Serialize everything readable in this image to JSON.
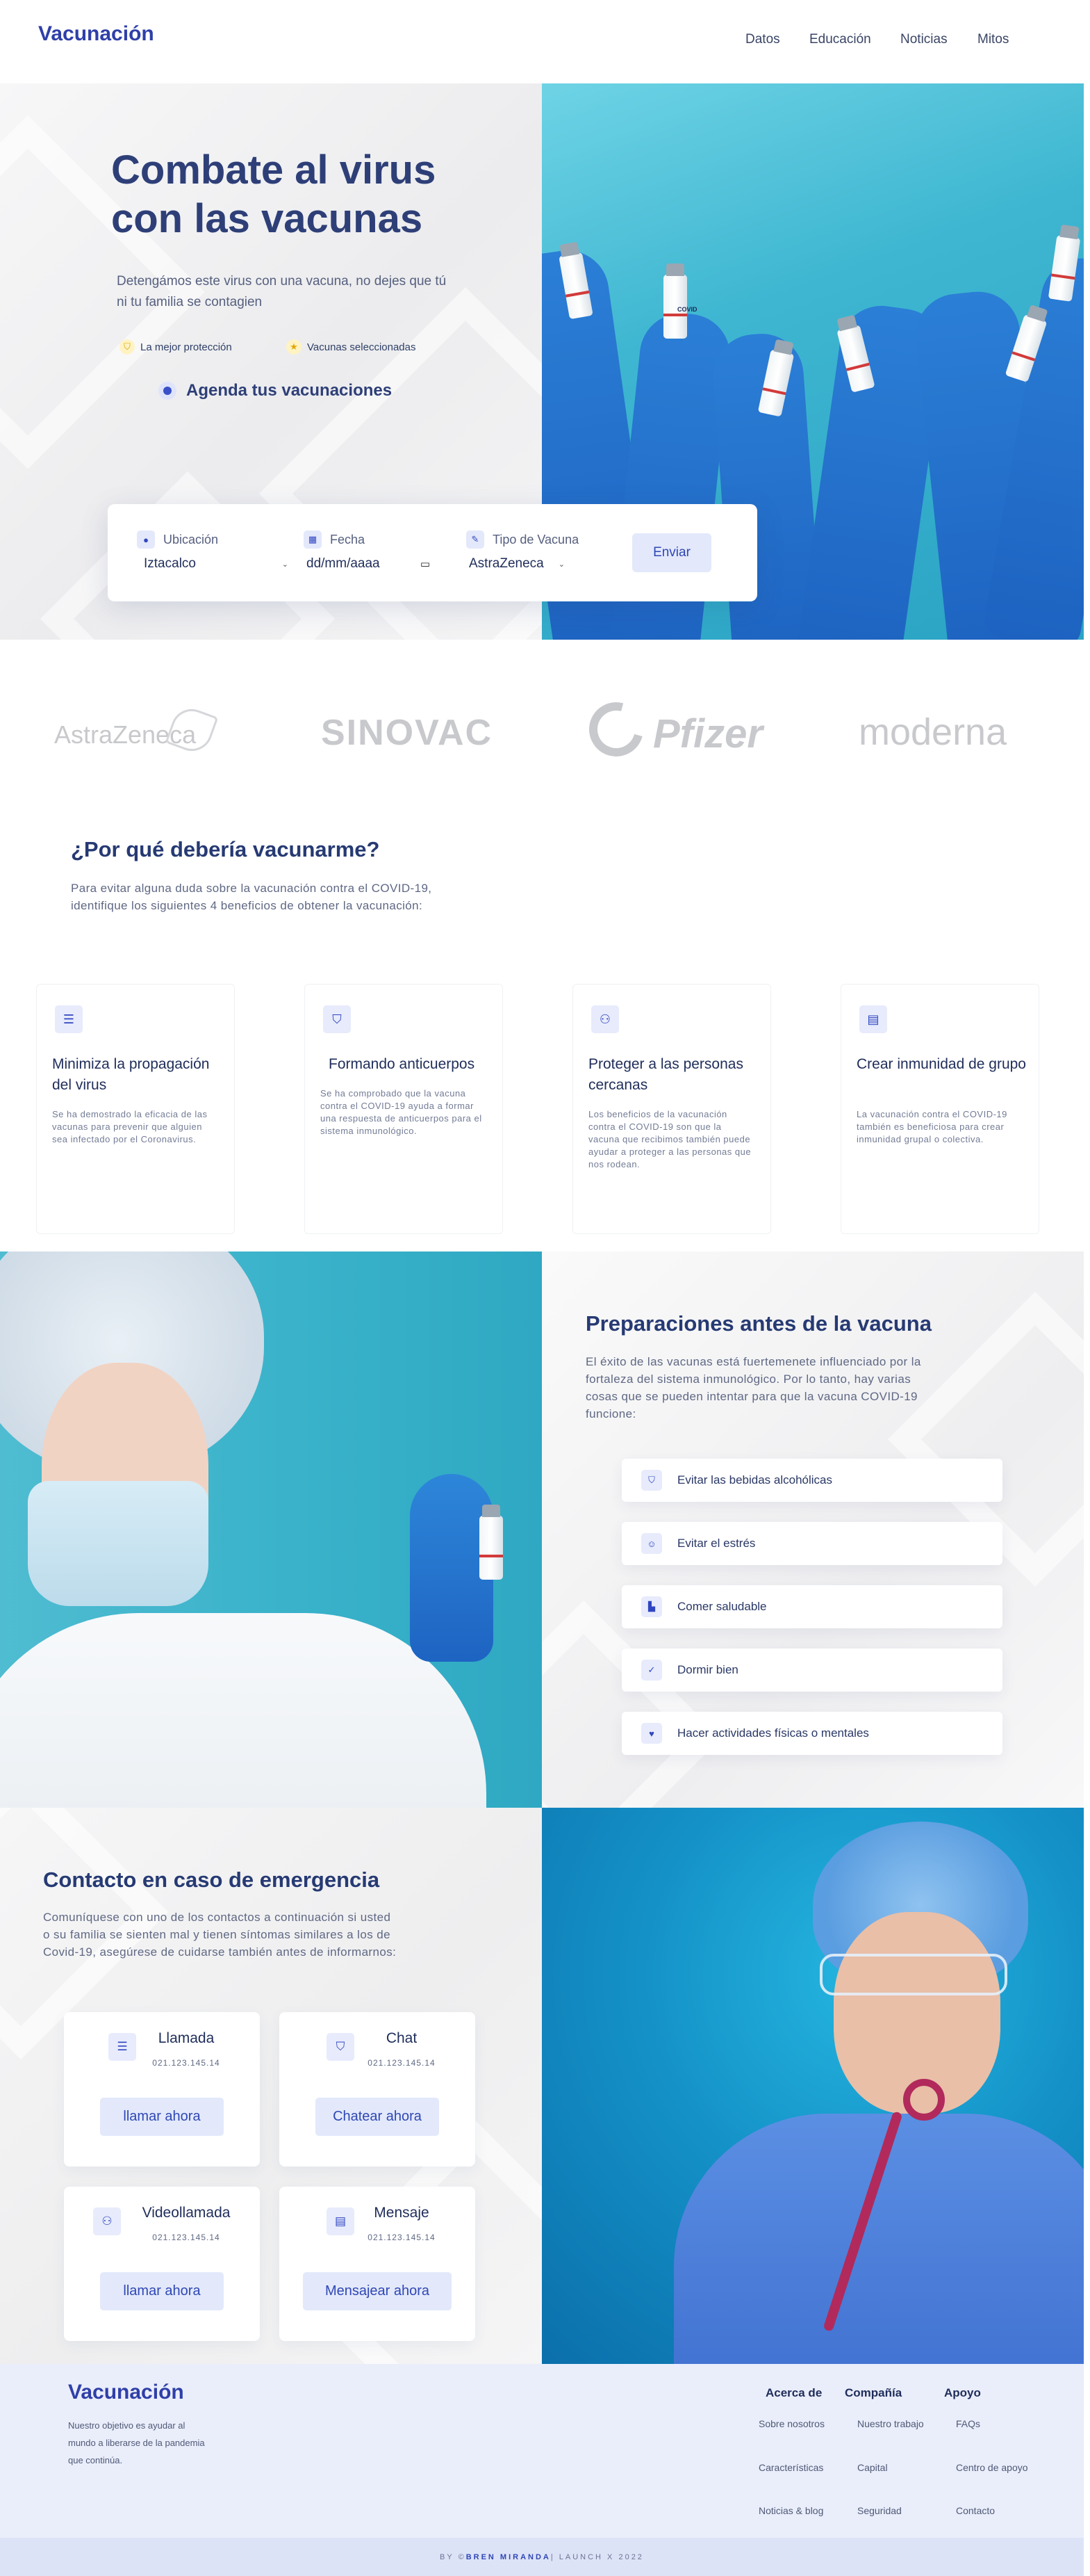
{
  "header": {
    "logo": "Vacunación",
    "nav": [
      "Datos",
      "Educación",
      "Noticias",
      "Mitos"
    ]
  },
  "hero": {
    "title": "Combate al virus con las vacunas",
    "subtitle": "Detengámos este virus con una vacuna, no dejes que tú ni tu familia se contagien",
    "badges": [
      {
        "label": "La mejor protección",
        "icon": "shield-icon"
      },
      {
        "label": "Vacunas seleccionadas",
        "icon": "star-icon"
      }
    ],
    "agenda_label": "Agenda tus vacunaciones",
    "vial_label": "COVID"
  },
  "booking": {
    "location_label": "Ubicación",
    "location_value": "Iztacalco",
    "date_label": "Fecha",
    "date_value": "dd/mm/aaaa",
    "type_label": "Tipo de Vacuna",
    "type_value": "AstraZeneca",
    "submit": "Enviar"
  },
  "brands": [
    "AstraZeneca",
    "SINOVAC",
    "Pfizer",
    "moderna"
  ],
  "why": {
    "title": "¿Por qué debería vacunarme?",
    "text": "Para evitar alguna duda sobre la vacunación contra el COVID-19, identifique los siguientes 4 beneficios de obtener la vacunación:",
    "cards": [
      {
        "title": "Minimiza la propagación del virus",
        "text": "Se ha demostrado la eficacia de las vacunas para prevenir que alguien sea infectado por el Coronavirus.",
        "icon": "list-icon"
      },
      {
        "title": "Formando anticuerpos",
        "text": "Se ha comprobado que la vacuna contra el COVID-19 ayuda a formar una respuesta de anticuerpos para el sistema inmunológico.",
        "icon": "shield-icon"
      },
      {
        "title": "Proteger a las personas cercanas",
        "text": "Los beneficios de la vacunación contra el COVID-19 son que la vacuna que recibimos también puede ayudar a proteger a las personas que nos rodean.",
        "icon": "people-icon"
      },
      {
        "title": "Crear inmunidad de grupo",
        "text": "La vacunación contra el COVID-19 también es beneficiosa para crear inmunidad grupal o colectiva.",
        "icon": "message-icon"
      }
    ]
  },
  "prep": {
    "title": "Preparaciones antes de la vacuna",
    "text": "El éxito de las vacunas está fuertemenete influenciado por la fortaleza del sistema inmunológico. Por lo tanto, hay varias cosas que se pueden intentar para que la vacuna COVID-19 funcione:",
    "items": [
      {
        "label": "Evitar las bebidas alcohólicas",
        "icon": "shield-icon"
      },
      {
        "label": "Evitar el estrés",
        "icon": "face-icon"
      },
      {
        "label": "Comer saludable",
        "icon": "chart-icon"
      },
      {
        "label": "Dormir bien",
        "icon": "check-icon"
      },
      {
        "label": "Hacer actividades físicas o mentales",
        "icon": "heart-icon"
      }
    ]
  },
  "contact": {
    "title": "Contacto en caso de emergencia",
    "text": "Comuníquese con uno de los contactos a continuación si usted o su familia se sienten mal y tienen síntomas similares a los de Covid-19, asegúrese de cuidarse también antes de informarnos:",
    "cards": [
      {
        "title": "Llamada",
        "number": "021.123.145.14",
        "button": "llamar ahora",
        "icon": "list-icon"
      },
      {
        "title": "Chat",
        "number": "021.123.145.14",
        "button": "Chatear ahora",
        "icon": "shield-icon"
      },
      {
        "title": "Videollamada",
        "number": "021.123.145.14",
        "button": "llamar ahora",
        "icon": "people-icon"
      },
      {
        "title": "Mensaje",
        "number": "021.123.145.14",
        "button": "Mensajear ahora",
        "icon": "message-icon"
      }
    ]
  },
  "footer": {
    "logo": "Vacunación",
    "tagline": "Nuestro objetivo es ayudar al mundo a liberarse de la pandemia que continúa.",
    "columns": [
      {
        "title": "Acerca de",
        "links": [
          "Sobre nosotros",
          "Características",
          "Noticias & blog"
        ]
      },
      {
        "title": "Compañía",
        "links": [
          "Nuestro trabajo",
          "Capital",
          "Seguridad"
        ]
      },
      {
        "title": "Apoyo",
        "links": [
          "FAQs",
          "Centro de apoyo",
          "Contacto"
        ]
      }
    ],
    "credit_prefix": "BY © ",
    "credit_name": "BREN MIRANDA",
    "credit_suffix": " | LAUNCH X 2022"
  },
  "colors": {
    "brand": "#2f3fa8",
    "accent_bg": "#e3e9fb",
    "heading": "#263a73",
    "footer_bg": "#eaeefb"
  }
}
